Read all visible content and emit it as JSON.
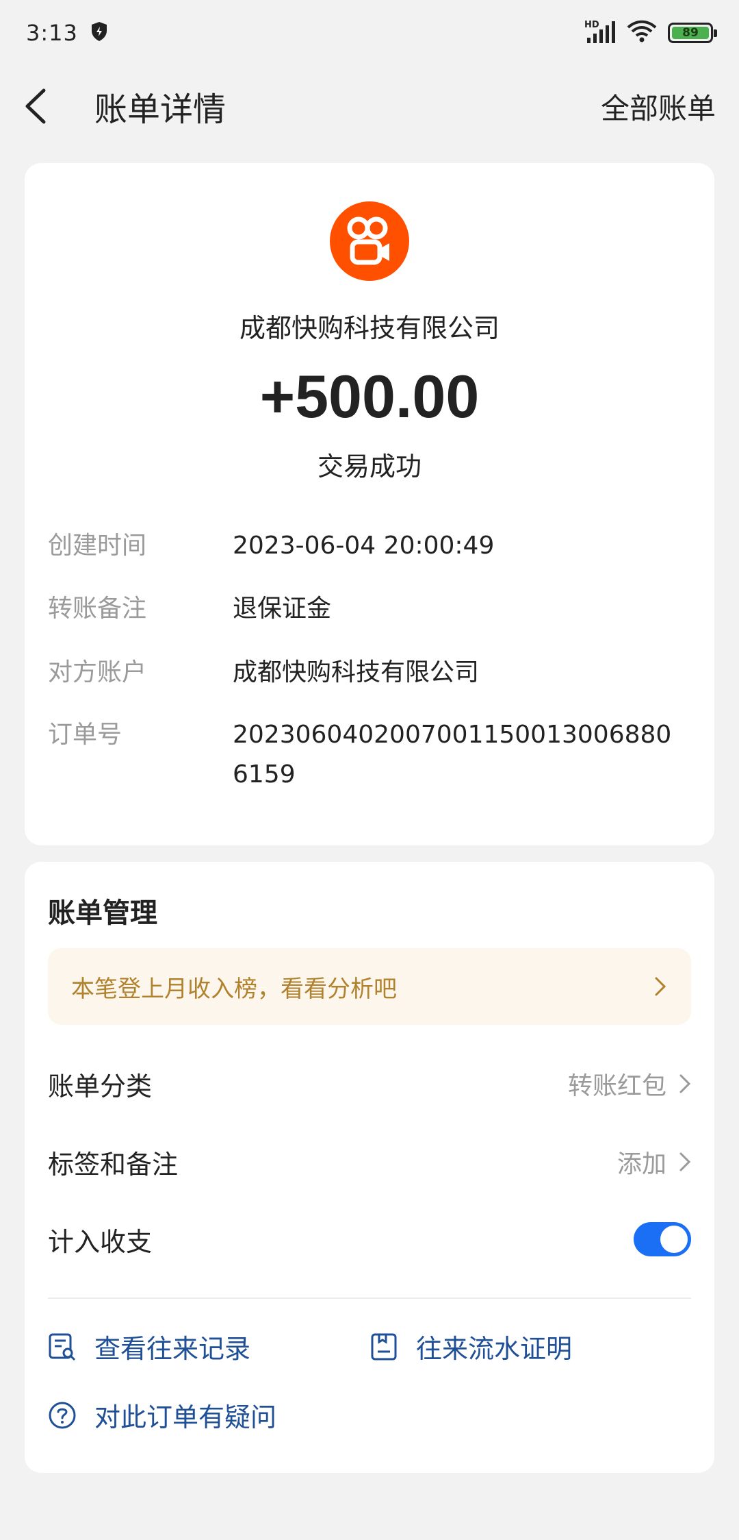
{
  "status_bar": {
    "time": "3:13",
    "network_label": "HD",
    "battery": "89"
  },
  "header": {
    "title": "账单详情",
    "right_link": "全部账单"
  },
  "transaction": {
    "merchant": "成都快购科技有限公司",
    "amount": "+500.00",
    "status": "交易成功",
    "logo_icon": "kuaishou-logo",
    "logo_color": "#ff5000",
    "details": [
      {
        "label": "创建时间",
        "value": "2023-06-04 20:00:49"
      },
      {
        "label": "转账备注",
        "value": "退保证金"
      },
      {
        "label": "对方账户",
        "value": "成都快购科技有限公司"
      },
      {
        "label": "订单号",
        "value": "20230604020070011500130068806159"
      }
    ]
  },
  "management": {
    "title": "账单管理",
    "promo": "本笔登上月收入榜，看看分析吧",
    "rows": [
      {
        "label": "账单分类",
        "value": "转账红包"
      },
      {
        "label": "标签和备注",
        "value": "添加"
      },
      {
        "label": "计入收支",
        "toggle_on": true
      }
    ],
    "links": [
      {
        "label": "查看往来记录",
        "icon": "record-search-icon"
      },
      {
        "label": "往来流水证明",
        "icon": "document-icon"
      },
      {
        "label": "对此订单有疑问",
        "icon": "question-icon"
      }
    ]
  },
  "colors": {
    "accent": "#1b6ff5",
    "link": "#1f4f96",
    "promo_text": "#b0822e",
    "promo_bg": "#fdf6ec"
  }
}
